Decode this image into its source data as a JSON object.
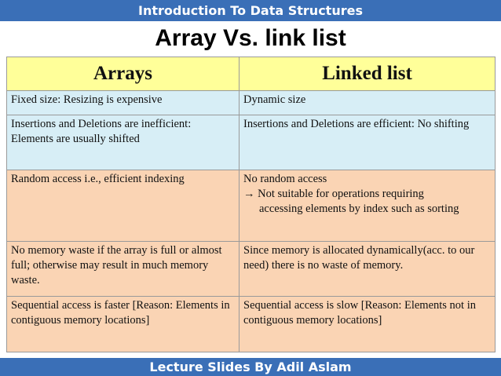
{
  "header": {
    "banner": "Introduction To Data Structures"
  },
  "title": "Array Vs. link list",
  "table": {
    "headers": [
      "Arrays",
      "Linked list"
    ],
    "rows": [
      {
        "arrays": "Fixed size:  Resizing is expensive",
        "linked": "Dynamic size"
      },
      {
        "arrays": "Insertions and Deletions are inefficient: Elements are usually shifted",
        "linked": "Insertions and Deletions are efficient: No shifting"
      },
      {
        "arrays": "Random access i.e., efficient indexing",
        "linked_line1": "No random access",
        "linked_line2": "→ Not suitable for operations requiring",
        "linked_line3": "accessing elements by index such as sorting"
      },
      {
        "arrays": "No memory waste if the array is full or almost full; otherwise may result in much memory waste.",
        "linked": "Since memory is allocated dynamically(acc. to our need) there is no waste of memory."
      },
      {
        "arrays": "Sequential access is faster  [Reason: Elements in contiguous memory locations]",
        "linked": "Sequential access is slow [Reason: Elements not in contiguous memory locations]"
      }
    ]
  },
  "footer": {
    "banner": "Lecture Slides By Adil Aslam"
  }
}
